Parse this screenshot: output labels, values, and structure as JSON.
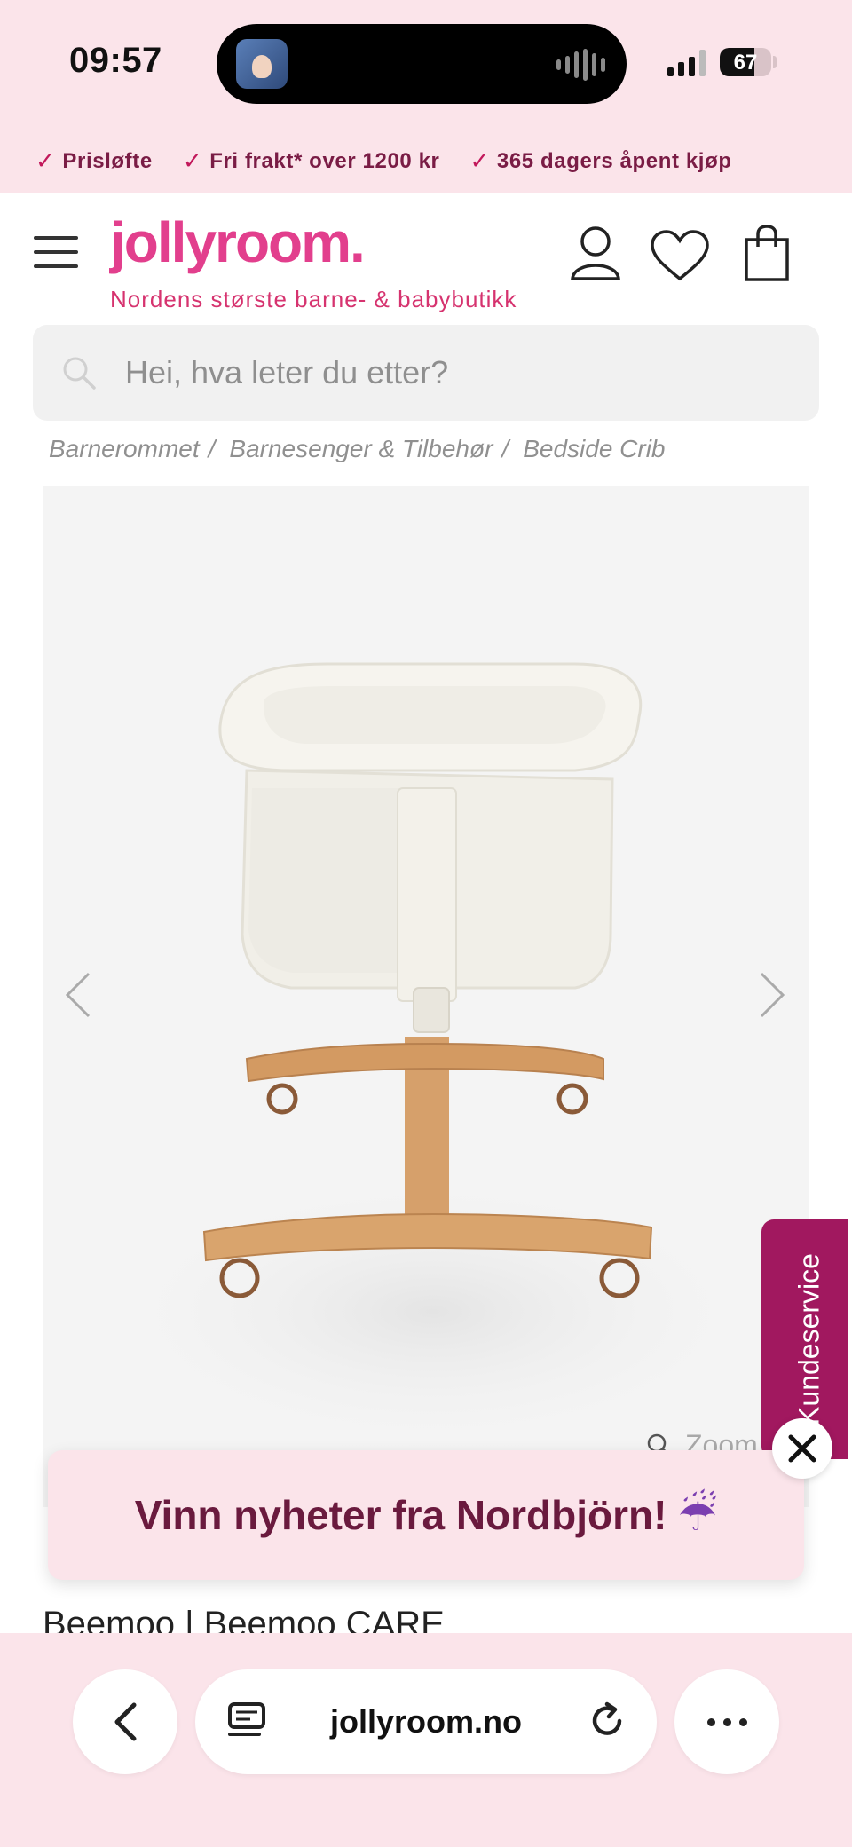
{
  "status_bar": {
    "time": "09:57",
    "battery": "67",
    "battery_level": 0.67
  },
  "usp": [
    {
      "label": "Prisløfte"
    },
    {
      "label": "Fri frakt* over 1200 kr"
    },
    {
      "label": "365 dagers åpent kjøp"
    }
  ],
  "header": {
    "logo": "jollyroom.",
    "tagline": "Nordens største barne- & babybutikk"
  },
  "search": {
    "placeholder": "Hei, hva leter du etter?"
  },
  "breadcrumb": [
    {
      "label": "Barnerommet"
    },
    {
      "label": "Barnesenger & Tilbehør"
    },
    {
      "label": "Bedside Crib"
    }
  ],
  "gallery": {
    "zoom_label": "Zoom"
  },
  "kundeservice": {
    "label": "Kundeservice"
  },
  "promo": {
    "text": "Vinn nyheter fra Nordbjörn!",
    "emoji": "☔"
  },
  "product": {
    "title": "Beemoo | Beemoo CARE"
  },
  "browser": {
    "url": "jollyroom.no"
  },
  "colors": {
    "brand": "#e23f8d",
    "brand_dark": "#7a1c45",
    "pink_bg": "#fbe4ea",
    "kunde_tab": "#a1185f"
  }
}
